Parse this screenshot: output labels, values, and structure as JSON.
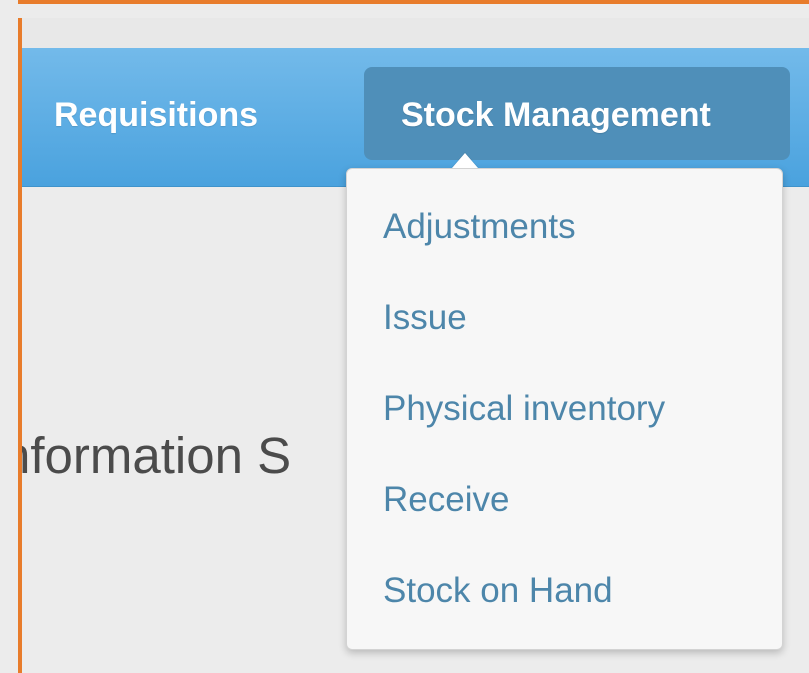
{
  "navigation": {
    "items": [
      {
        "label": "Requisitions"
      },
      {
        "label": "Stock Management"
      }
    ]
  },
  "dropdown": {
    "items": [
      {
        "label": "Adjustments"
      },
      {
        "label": "Issue"
      },
      {
        "label": "Physical inventory"
      },
      {
        "label": "Receive"
      },
      {
        "label": "Stock on Hand"
      }
    ]
  },
  "content": {
    "partial_heading": "nformation S"
  },
  "colors": {
    "highlight_border": "#e87c2b",
    "nav_gradient_top": "#73baea",
    "nav_gradient_bottom": "#4aa2de",
    "active_nav_background": "#4f8fb9",
    "dropdown_link": "#4d86aa",
    "background": "#ececec"
  },
  "icons": {
    "dropdown_pointer": "caret-up-icon"
  }
}
